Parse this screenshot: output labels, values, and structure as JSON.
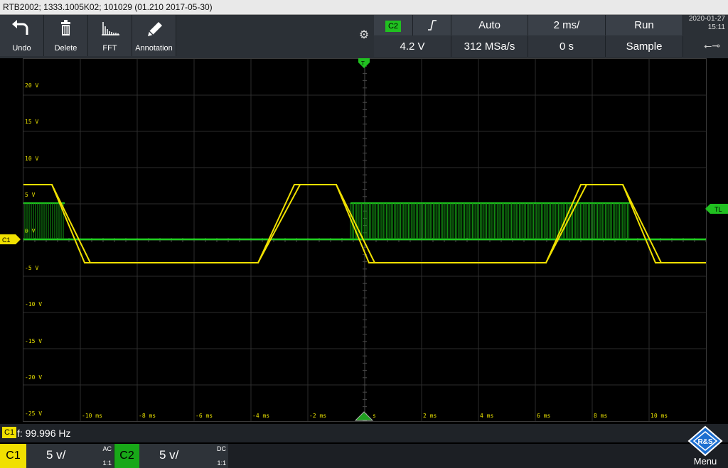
{
  "title_bar": {
    "text": "RTB2002; 1333.1005K02; 101029 (01.210 2017-05-30)"
  },
  "toolbar": {
    "buttons": [
      {
        "label": "Undo",
        "icon": "undo-icon"
      },
      {
        "label": "Delete",
        "icon": "trash-icon"
      },
      {
        "label": "FFT",
        "icon": "fft-icon"
      },
      {
        "label": "Annotation",
        "icon": "pencil-icon"
      }
    ]
  },
  "info": {
    "trigger_source": "C2",
    "trigger_slope_icon": "rising-edge-icon",
    "trigger_mode": "Auto",
    "time_scale": "2 ms/",
    "run_state": "Run",
    "trigger_level": "4.2 V",
    "sample_rate": "312 MSa/s",
    "time_offset": "0 s",
    "acq_mode": "Sample"
  },
  "datetime": {
    "date": "2020-01-27",
    "time": "15:11"
  },
  "scope": {
    "y_labels": [
      "20 V",
      "15 V",
      "10 V",
      "5 V",
      "0 V",
      "-5 V",
      "-10 V",
      "-15 V",
      "-20 V",
      "-25 V"
    ],
    "x_labels": [
      "-10 ms",
      "-8 ms",
      "-6 ms",
      "-4 ms",
      "-2 ms",
      "s",
      "2 ms",
      "4 ms",
      "6 ms",
      "8 ms",
      "10 ms"
    ],
    "ch1_marker": "C1",
    "trigger_level_marker": "TL",
    "trigger_marker": "T"
  },
  "status": {
    "badge": "C1",
    "measurement": "f: 99.996 Hz"
  },
  "channels": [
    {
      "tab": "C1",
      "scale": "5 v/",
      "coupling": "AC",
      "ratio": "1:1",
      "color": "#f0e000"
    },
    {
      "tab": "C2",
      "scale": "5 v/",
      "coupling": "DC",
      "ratio": "1:1",
      "color": "#18a818"
    }
  ],
  "menu": {
    "label": "Menu",
    "logo_text": "R&S"
  },
  "colors": {
    "ch1": "#f0e000",
    "ch2": "#20d020",
    "grid": "#2d2d2d"
  }
}
